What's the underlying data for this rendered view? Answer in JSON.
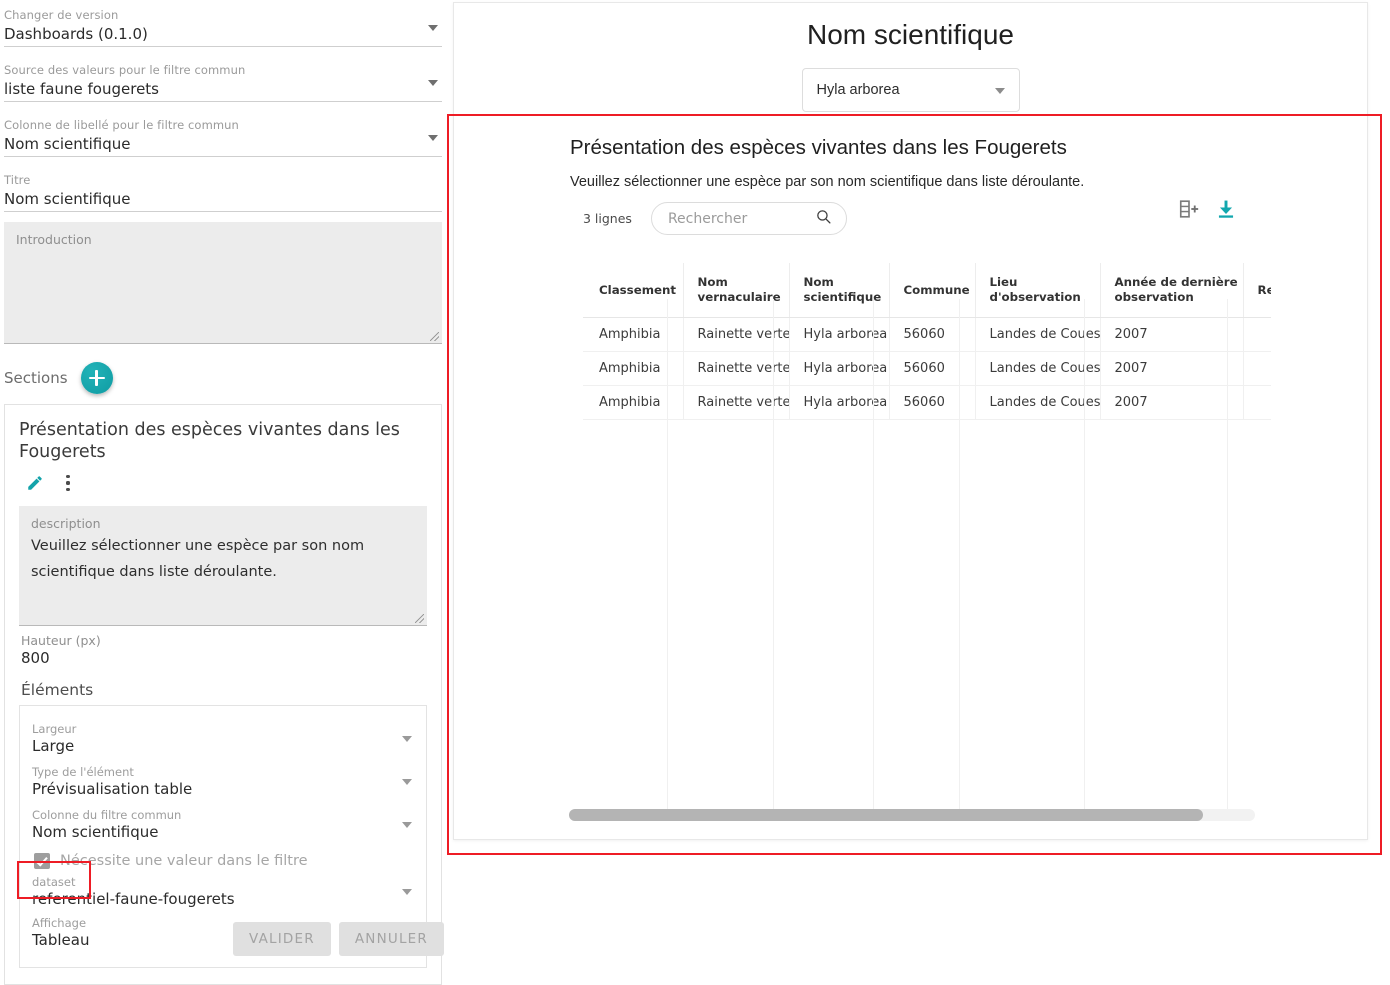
{
  "sidebar": {
    "fields": [
      {
        "label": "Changer de version",
        "value": "Dashboards (0.1.0)",
        "icon": "chevron-down-icon"
      },
      {
        "label": "Source des valeurs pour le filtre commun",
        "value": "liste faune fougerets",
        "icon": "chevron-down-icon"
      },
      {
        "label": "Colonne de libellé pour le filtre commun",
        "value": "Nom scientifique",
        "icon": "chevron-down-icon"
      },
      {
        "label": "Titre",
        "value": "Nom scientifique",
        "icon": ""
      }
    ],
    "introduction": {
      "placeholder": "Introduction",
      "value": ""
    },
    "sections_label": "Sections",
    "add_section_icon": "plus-icon",
    "section": {
      "title": "Présentation des espèces vivantes dans les Fougerets",
      "edit_icon": "pencil-icon",
      "menu_icon": "more-vertical-icon",
      "description_label": "description",
      "description_value": "Veuillez sélectionner une espèce par son nom scientifique dans liste déroulante.",
      "height_label": "Hauteur (px)",
      "height_value": "800",
      "elements_label": "Éléments",
      "elements": [
        {
          "label": "Largeur",
          "value": "Large"
        },
        {
          "label": "Type de l'élément",
          "value": "Prévisualisation table"
        },
        {
          "label": "Colonne du filtre commun",
          "value": "Nom scientifique"
        }
      ],
      "checkbox": {
        "label": "Nécessite une valeur dans le filtre",
        "checked": true
      },
      "dataset": {
        "label": "dataset",
        "value": "referentiel-faune-fougerets"
      },
      "affichage": {
        "label": "Affichage",
        "value": "Tableau"
      }
    },
    "buttons": {
      "validate": "VALIDER",
      "cancel": "ANNULER"
    }
  },
  "preview": {
    "title": "Nom scientifique",
    "filter_select": {
      "value": "Hyla arborea",
      "icon": "chevron-down-icon"
    },
    "section_title": "Présentation des espèces vivantes dans les Fougerets",
    "section_description": "Veuillez sélectionner une espèce par son nom scientifique dans liste déroulante.",
    "rows_count": "3 lignes",
    "search_placeholder": "Rechercher",
    "search_icon": "search-icon",
    "add_column_icon": "table-add-column-icon",
    "download_icon": "download-icon"
  },
  "table_data": {
    "type": "table",
    "columns": [
      "Classement",
      "Nom vernaculaire",
      "Nom scientifique",
      "Commune",
      "Lieu d'observation",
      "Année de dernière observation",
      "Remarq"
    ],
    "rows": [
      [
        "Amphibia",
        "Rainette verte",
        "Hyla arborea",
        "56060",
        "Landes de Couesmé",
        "2007",
        ""
      ],
      [
        "Amphibia",
        "Rainette verte",
        "Hyla arborea",
        "56060",
        "Landes de Couesmé",
        "2007",
        ""
      ],
      [
        "Amphibia",
        "Rainette verte",
        "Hyla arborea",
        "56060",
        "Landes de Couesmé",
        "2007",
        ""
      ]
    ]
  },
  "colors": {
    "accent": "#13a3aa",
    "highlight": "#ee1c25",
    "text": "#2b2b2b",
    "muted": "#9a9a9a"
  }
}
